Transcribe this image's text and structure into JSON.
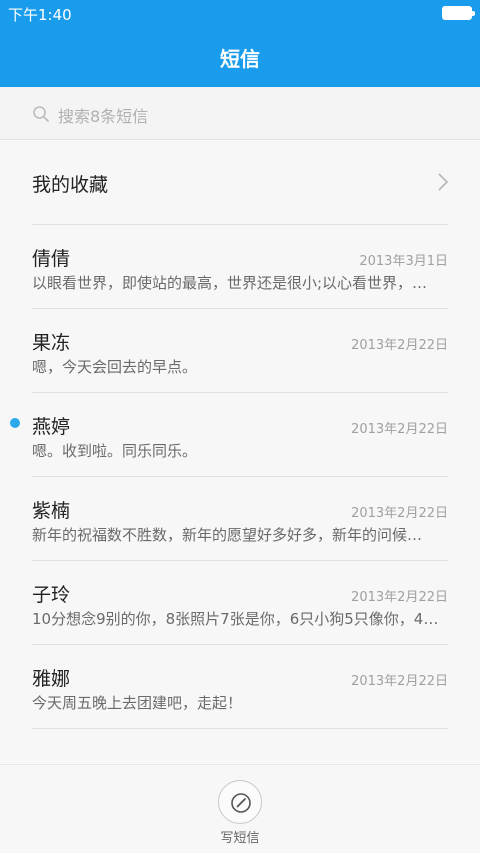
{
  "status_bar": {
    "time": "下午1:40"
  },
  "header": {
    "title": "短信"
  },
  "search": {
    "placeholder": "搜索8条短信"
  },
  "favorites": {
    "label": "我的收藏"
  },
  "conversations": [
    {
      "name": "倩倩",
      "date": "2013年3月1日",
      "preview": "以眼看世界，即使站的最高，世界还是很小;以心看世界，…",
      "unread": false
    },
    {
      "name": "果冻",
      "date": "2013年2月22日",
      "preview": "嗯，今天会回去的早点。",
      "unread": false
    },
    {
      "name": "燕婷",
      "date": "2013年2月22日",
      "preview": "嗯。收到啦。同乐同乐。",
      "unread": true
    },
    {
      "name": "紫楠",
      "date": "2013年2月22日",
      "preview": "新年的祝福数不胜数，新年的愿望好多好多，新年的问候…",
      "unread": false
    },
    {
      "name": "子玲",
      "date": "2013年2月22日",
      "preview": "10分想念9别的你，8张照片7张是你，6只小狗5只像你，4…",
      "unread": false
    },
    {
      "name": "雅娜",
      "date": "2013年2月22日",
      "preview": "今天周五晚上去团建吧，走起！",
      "unread": false
    }
  ],
  "bottom": {
    "compose_label": "写短信"
  },
  "colors": {
    "accent": "#1a9cec",
    "unread_dot": "#29a8ec"
  }
}
